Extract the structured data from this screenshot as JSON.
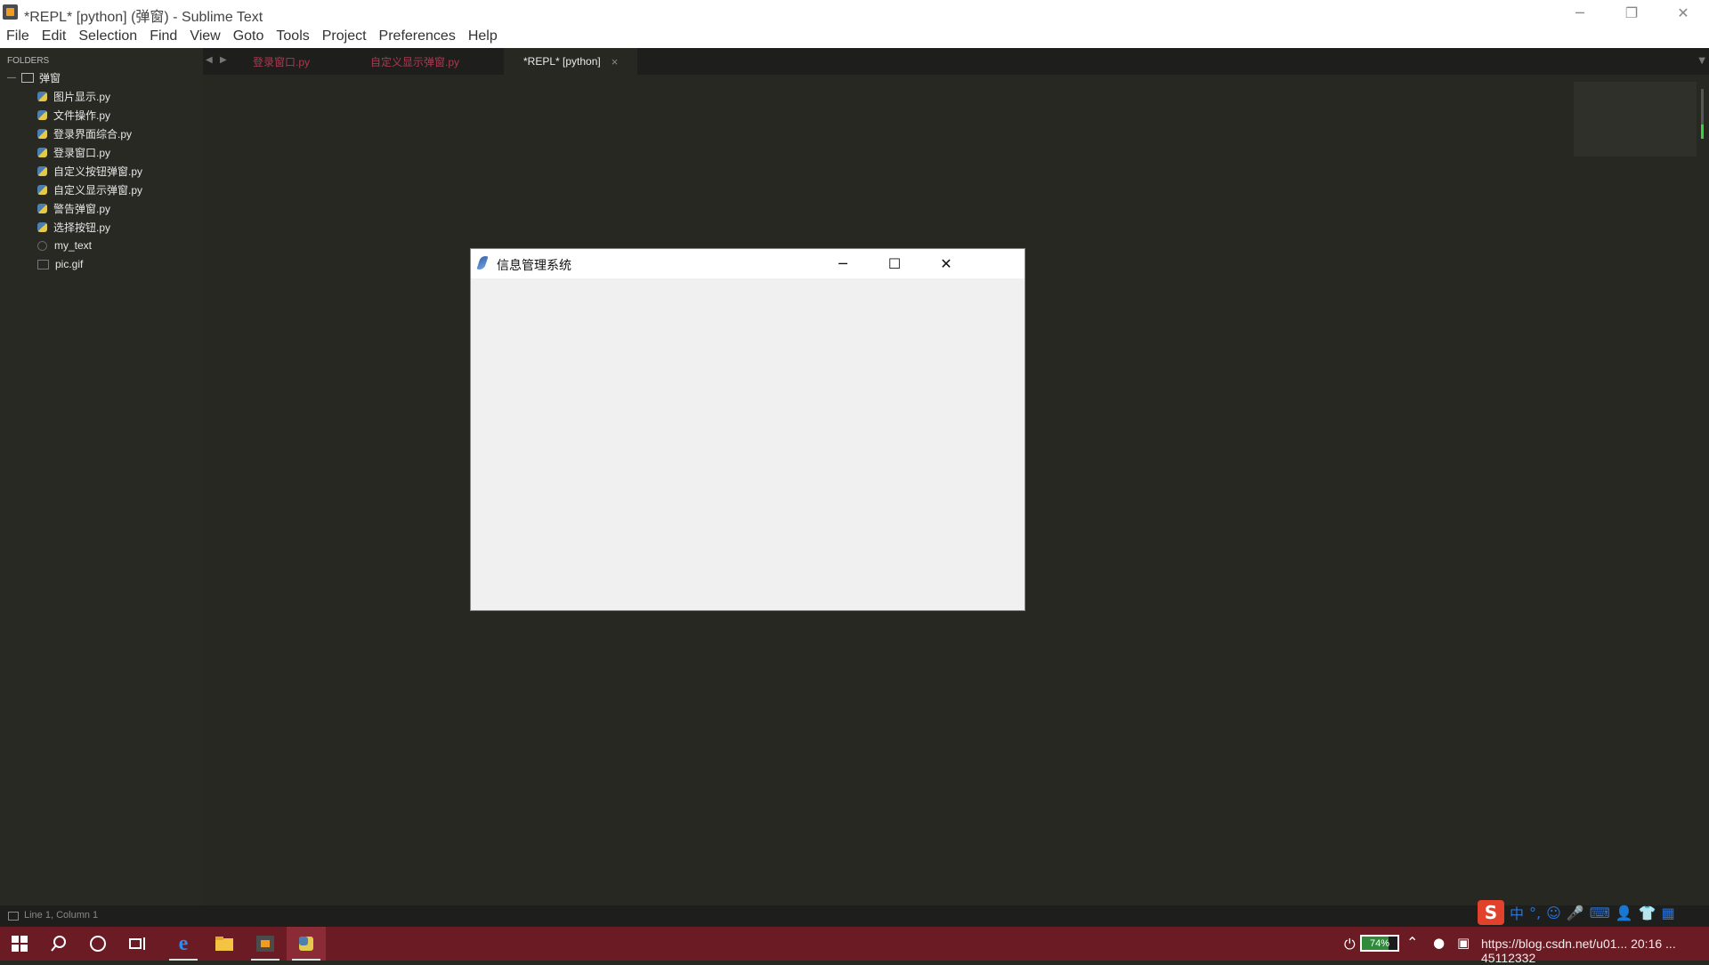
{
  "window": {
    "title": "*REPL* [python] (弹窗) - Sublime Text",
    "controls": {
      "minimize": "─",
      "restore": "❐",
      "close": "✕"
    }
  },
  "menu": [
    "File",
    "Edit",
    "Selection",
    "Find",
    "View",
    "Goto",
    "Tools",
    "Project",
    "Preferences",
    "Help"
  ],
  "sidebar": {
    "header": "FOLDERS",
    "folder": {
      "name": "弹窗",
      "expand_glyph": "—"
    },
    "files": [
      {
        "name": "图片显示.py",
        "icon": "python-file-icon"
      },
      {
        "name": "文件操作.py",
        "icon": "python-file-icon"
      },
      {
        "name": "登录界面综合.py",
        "icon": "python-file-icon"
      },
      {
        "name": "登录窗口.py",
        "icon": "python-file-icon"
      },
      {
        "name": "自定义按钮弹窗.py",
        "icon": "python-file-icon"
      },
      {
        "name": "自定义显示弹窗.py",
        "icon": "python-file-icon"
      },
      {
        "name": "警告弹窗.py",
        "icon": "python-file-icon"
      },
      {
        "name": "选择按钮.py",
        "icon": "python-file-icon"
      },
      {
        "name": "my_text",
        "icon": "generic-file-icon"
      },
      {
        "name": "pic.gif",
        "icon": "image-file-icon"
      }
    ]
  },
  "tabs": [
    {
      "label": "登录窗口.py",
      "active": false
    },
    {
      "label": "自定义显示弹窗.py",
      "active": false
    },
    {
      "label": "*REPL* [python]",
      "active": true,
      "close": "×"
    }
  ],
  "tab_nav": {
    "prev": "◀",
    "next": "▶",
    "overflow": "▼"
  },
  "status": {
    "text": "Line 1, Column 1"
  },
  "dialog": {
    "title": "信息管理系统",
    "controls": {
      "minimize": "─",
      "maximize": "☐",
      "close": "✕"
    }
  },
  "ime": {
    "logo": "S",
    "items": [
      "中",
      "°,",
      "☺",
      "🎤",
      "⌨",
      "👤",
      "👕",
      "▦"
    ]
  },
  "taskbar": {
    "icons": [
      "windows-start-icon",
      "search-icon",
      "cortana-icon",
      "task-view-icon",
      "edge-icon",
      "file-explorer-icon",
      "sublime-icon",
      "python-icon"
    ],
    "battery": {
      "percent": "74%",
      "level": 0.74
    },
    "tray_text": "https://blog.csdn.net/u01... 20:16 ... 45112332"
  },
  "colors": {
    "editor_bg": "#272822",
    "taskbar": "#6b1b24",
    "tab_inactive_text": "#aa3a52"
  }
}
